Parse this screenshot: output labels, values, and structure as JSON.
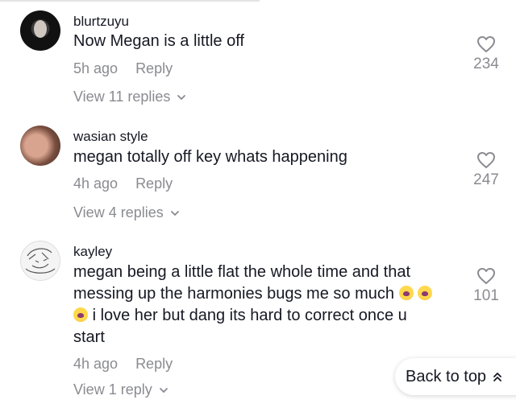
{
  "comments": [
    {
      "username": "blurtzuyu",
      "text": [
        "Now Megan is a little off"
      ],
      "time": "5h ago",
      "reply_label": "Reply",
      "likes": "234",
      "view_replies": "View 11 replies"
    },
    {
      "username": "wasian style",
      "text": [
        "megan totally off key whats happening"
      ],
      "time": "4h ago",
      "reply_label": "Reply",
      "likes": "247",
      "view_replies": "View 4 replies"
    },
    {
      "username": "kayley",
      "text": [
        "megan being a little flat the whole time and that",
        "messing up the harmonies bugs me so much",
        "i love her but dang its hard to correct once u",
        "start"
      ],
      "time": "4h ago",
      "reply_label": "Reply",
      "likes": "101",
      "view_replies": "View 1 reply"
    }
  ],
  "back_to_top": "Back to top",
  "icons": [
    "heart-outline-icon",
    "chevron-down-icon",
    "double-chevron-up-icon",
    "crying-face-emoji"
  ]
}
